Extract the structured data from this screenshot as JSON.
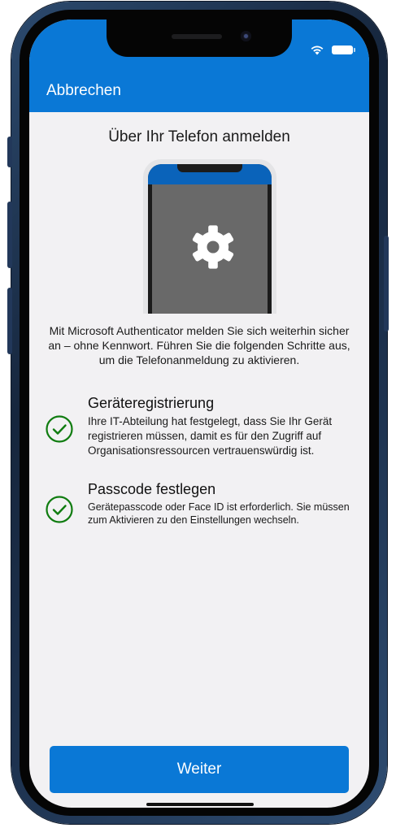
{
  "status_bar": {
    "wifi_icon": "wifi-icon",
    "battery_icon": "battery-icon"
  },
  "header": {
    "cancel_label": "Abbrechen",
    "background_color": "#0a78d6"
  },
  "main": {
    "title": "Über Ihr Telefon anmelden",
    "illustration_icon": "gear-icon",
    "intro": "Mit Microsoft Authenticator melden Sie sich weiterhin sicher an – ohne Kennwort. Führen Sie die folgenden Schritte aus, um die Telefonanmeldung zu aktivieren.",
    "steps": [
      {
        "title": "Geräteregistrierung",
        "description": "Ihre IT-Abteilung hat festgelegt, dass Sie Ihr Gerät registrieren müssen, damit es für den Zugriff auf Organisationsressourcen vertrauenswürdig ist.",
        "icon": "check-circle-icon",
        "completed": true
      },
      {
        "title": "Passcode festlegen",
        "description": "Gerätepasscode oder Face ID ist erforderlich. Sie müssen zum Aktivieren zu den Einstellungen wechseln.",
        "icon": "check-circle-icon",
        "completed": true
      }
    ]
  },
  "footer": {
    "continue_label": "Weiter",
    "button_color": "#0a78d6"
  },
  "colors": {
    "accent": "#0a78d6",
    "check_green": "#107c10",
    "screen_background": "#f2f1f3"
  }
}
